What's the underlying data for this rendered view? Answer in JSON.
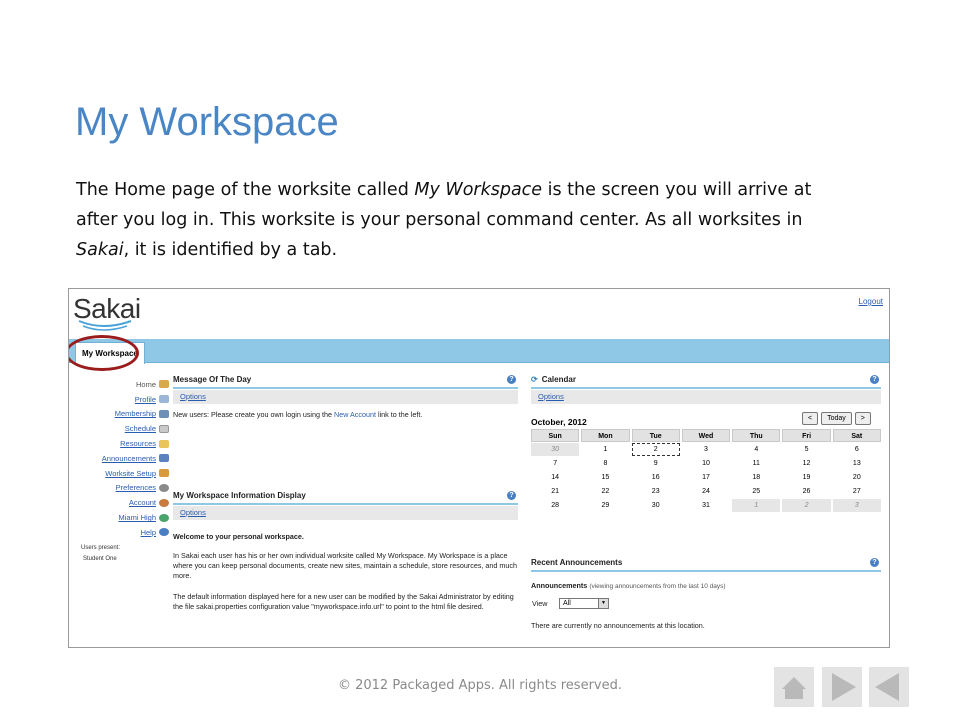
{
  "slide": {
    "title": "My Workspace",
    "intro": {
      "t1": "The Home page of the worksite called ",
      "t2": "My Workspace",
      "t3": " is the screen you will arrive at after you log in. This worksite is your personal command center. As all worksites in ",
      "t4": "Sakai",
      "t5": ", it is identified by a tab."
    },
    "footer": "© 2012 Packaged Apps.  All rights reserved."
  },
  "sakai": {
    "logo": "Sakai",
    "logout": "Logout",
    "tab": "My Workspace",
    "nav": [
      "Home",
      "Profile",
      "Membership",
      "Schedule",
      "Resources",
      "Announcements",
      "Worksite Setup",
      "Preferences",
      "Account",
      "Miami High",
      "Help"
    ],
    "users_present_label": "Users present:",
    "user": "Student One",
    "motd": {
      "title": "Message Of The Day",
      "options": "Options",
      "text_a": "New users:  Please create you own login using the ",
      "link": "New Account",
      "text_b": " link to the left."
    },
    "info": {
      "title": "My Workspace Information Display",
      "options": "Options",
      "welcome": "Welcome to your personal workspace.",
      "p1": "In Sakai each user has his or her own individual worksite called My Workspace. My Workspace is a place where you can keep personal documents, create new sites, maintain a schedule, store resources, and much more.",
      "p2": "The default information displayed here for a new user can be modified by the Sakai Administrator by editing the file sakai.properties configuration value \"myworkspace.info.url\" to point to the html file desired."
    },
    "calendar": {
      "title": "Calendar",
      "options": "Options",
      "month": "October, 2012",
      "prev": "<",
      "today": "Today",
      "next": ">",
      "days": [
        "Sun",
        "Mon",
        "Tue",
        "Wed",
        "Thu",
        "Fri",
        "Sat"
      ],
      "weeks": [
        [
          "30",
          "1",
          "2",
          "3",
          "4",
          "5",
          "6"
        ],
        [
          "7",
          "8",
          "9",
          "10",
          "11",
          "12",
          "13"
        ],
        [
          "14",
          "15",
          "16",
          "17",
          "18",
          "19",
          "20"
        ],
        [
          "21",
          "22",
          "23",
          "24",
          "25",
          "26",
          "27"
        ],
        [
          "28",
          "29",
          "30",
          "31",
          "1",
          "2",
          "3"
        ]
      ]
    },
    "announcements": {
      "title": "Recent Announcements",
      "heading": "Announcements",
      "sub": "(viewing announcements from the last 10 days)",
      "view_label": "View",
      "view_value": "All",
      "empty": "There are currently no announcements at this location."
    }
  },
  "colors": {
    "title": "#4a86c5",
    "tabbar": "#8ec8e6",
    "ring": "#9b1c1c",
    "link": "#2a5db0"
  }
}
